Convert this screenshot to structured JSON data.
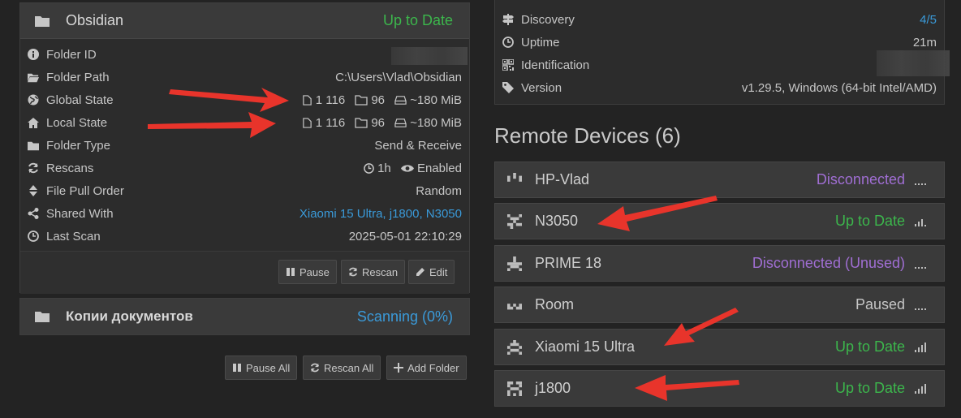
{
  "folder": {
    "name": "Obsidian",
    "status": "Up to Date",
    "rows": [
      {
        "label": "Folder ID",
        "value": ""
      },
      {
        "label": "Folder Path",
        "value": "C:\\Users\\Vlad\\Obsidian"
      },
      {
        "label": "Global State",
        "files": "1 116",
        "dirs": "96",
        "size": "~180 MiB"
      },
      {
        "label": "Local State",
        "files": "1 116",
        "dirs": "96",
        "size": "~180 MiB"
      },
      {
        "label": "Folder Type",
        "value": "Send & Receive"
      },
      {
        "label": "Rescans",
        "interval": "1h",
        "watch": "Enabled"
      },
      {
        "label": "File Pull Order",
        "value": "Random"
      },
      {
        "label": "Shared With",
        "value": "Xiaomi 15 Ultra, j1800, N3050"
      },
      {
        "label": "Last Scan",
        "value": "2025-05-01 22:10:29"
      }
    ],
    "buttons": {
      "pause": "Pause",
      "rescan": "Rescan",
      "edit": "Edit"
    }
  },
  "folder2": {
    "name": "Копии документов",
    "status": "Scanning (0%)"
  },
  "global_buttons": {
    "pause_all": "Pause All",
    "rescan_all": "Rescan All",
    "add_folder": "Add Folder"
  },
  "this_device": {
    "rows": [
      {
        "label": "Discovery",
        "value": "4/5"
      },
      {
        "label": "Uptime",
        "value": "21m"
      },
      {
        "label": "Identification",
        "value": ""
      },
      {
        "label": "Version",
        "value": "v1.29.5, Windows (64-bit Intel/AMD)"
      }
    ]
  },
  "remote": {
    "title": "Remote Devices (6)",
    "devices": [
      {
        "name": "HP-Vlad",
        "status": "Disconnected",
        "status_color": "#a06ed3"
      },
      {
        "name": "N3050",
        "status": "Up to Date",
        "status_color": "#3cb64c"
      },
      {
        "name": "PRIME 18",
        "status": "Disconnected (Unused)",
        "status_color": "#a06ed3"
      },
      {
        "name": "Room",
        "status": "Paused",
        "status_color": "#c6c6c6"
      },
      {
        "name": "Xiaomi 15 Ultra",
        "status": "Up to Date",
        "status_color": "#3cb64c"
      },
      {
        "name": "j1800",
        "status": "Up to Date",
        "status_color": "#3cb64c"
      }
    ]
  },
  "colors": {
    "accent_green": "#3cb64c",
    "accent_blue": "#3a9ad9",
    "accent_purple": "#a06ed3",
    "arrow_red": "#e8342b"
  }
}
